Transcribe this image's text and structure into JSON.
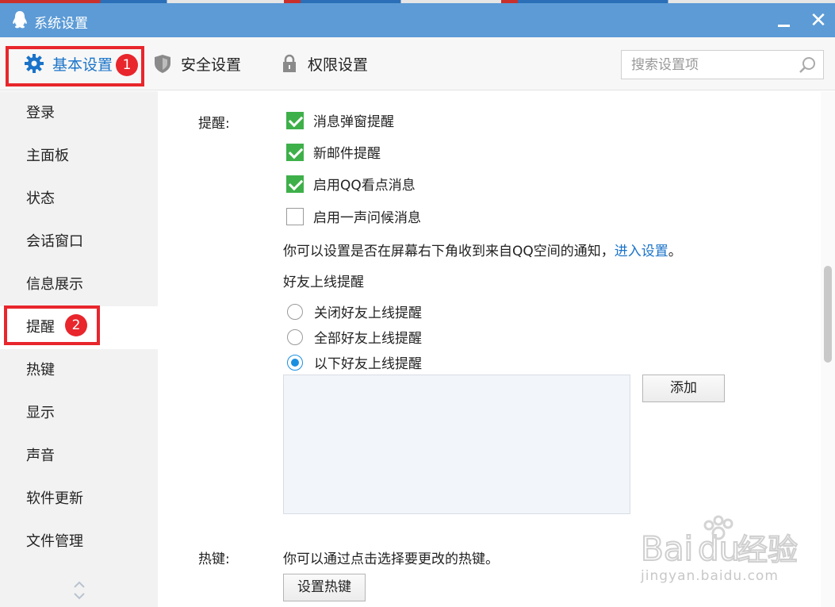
{
  "window": {
    "title": "系统设置"
  },
  "tabs": [
    {
      "label": "基本设置"
    },
    {
      "label": "安全设置"
    },
    {
      "label": "权限设置"
    }
  ],
  "search": {
    "placeholder": "搜索设置项"
  },
  "annotations": {
    "badge1": "1",
    "badge2": "2",
    "highlight_color": "#e8262c"
  },
  "sidebar": {
    "items": [
      {
        "label": "登录"
      },
      {
        "label": "主面板"
      },
      {
        "label": "状态"
      },
      {
        "label": "会话窗口"
      },
      {
        "label": "信息展示"
      },
      {
        "label": "提醒"
      },
      {
        "label": "热键"
      },
      {
        "label": "显示"
      },
      {
        "label": "声音"
      },
      {
        "label": "软件更新"
      },
      {
        "label": "文件管理"
      }
    ],
    "active_index": 5
  },
  "reminder": {
    "section_label": "提醒:",
    "checkboxes": [
      {
        "label": "消息弹窗提醒",
        "checked": true
      },
      {
        "label": "新邮件提醒",
        "checked": true
      },
      {
        "label": "启用QQ看点消息",
        "checked": true
      },
      {
        "label": "启用一声问候消息",
        "checked": false
      }
    ],
    "notice_text": "你可以设置是否在屏幕右下角收到来自QQ空间的通知，",
    "notice_link": "进入设置",
    "notice_end": "。",
    "friend_online_title": "好友上线提醒",
    "radios": [
      {
        "label": "关闭好友上线提醒",
        "selected": false
      },
      {
        "label": "全部好友上线提醒",
        "selected": false
      },
      {
        "label": "以下好友上线提醒",
        "selected": true
      }
    ],
    "add_button": "添加"
  },
  "hotkey": {
    "section_label": "热键:",
    "description": "你可以通过点击选择要更改的热键。",
    "button": "设置热键"
  },
  "watermark": {
    "text": "jingyan.baidu.com"
  },
  "colors": {
    "titlebar": "#5c9bd6",
    "accent": "#1a73c9",
    "check": "#3eb049",
    "radio": "#1a8fe0"
  }
}
